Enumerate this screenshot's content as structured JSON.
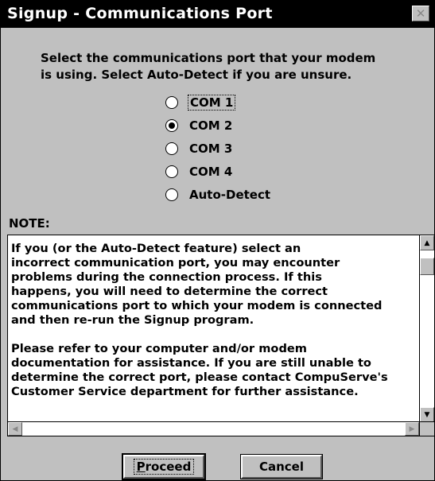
{
  "window": {
    "title": "Signup - Communications Port",
    "close_glyph": "✕"
  },
  "instruction": {
    "line1": "Select the communications port that your modem",
    "line2": "is using.  Select Auto-Detect if you are unsure."
  },
  "ports": {
    "selected": "COM 2",
    "options": [
      {
        "label": "COM 1",
        "checked": false,
        "focused": true
      },
      {
        "label": "COM 2",
        "checked": true,
        "focused": false
      },
      {
        "label": "COM 3",
        "checked": false,
        "focused": false
      },
      {
        "label": "COM 4",
        "checked": false,
        "focused": false
      },
      {
        "label": "Auto-Detect",
        "checked": false,
        "focused": false
      }
    ]
  },
  "note": {
    "label": "NOTE:",
    "lines": [
      "If you (or the Auto-Detect feature) select an",
      "incorrect communication port, you may encounter",
      "problems during the connection process.  If this",
      "happens, you will need to determine the correct",
      "communications port to which your modem is connected",
      "and then re-run the Signup program.",
      "",
      "Please refer to your computer and/or modem",
      "documentation for assistance.  If you are still unable to",
      "determine the correct port, please contact CompuServe's",
      "Customer Service department for further assistance."
    ]
  },
  "icons": {
    "scroll_up": "▲",
    "scroll_down": "▼",
    "scroll_left": "◀",
    "scroll_right": "▶"
  },
  "buttons": {
    "proceed_label": "Proceed",
    "proceed_mnemonic": "P",
    "proceed_rest": "roceed",
    "cancel_label": "Cancel"
  }
}
